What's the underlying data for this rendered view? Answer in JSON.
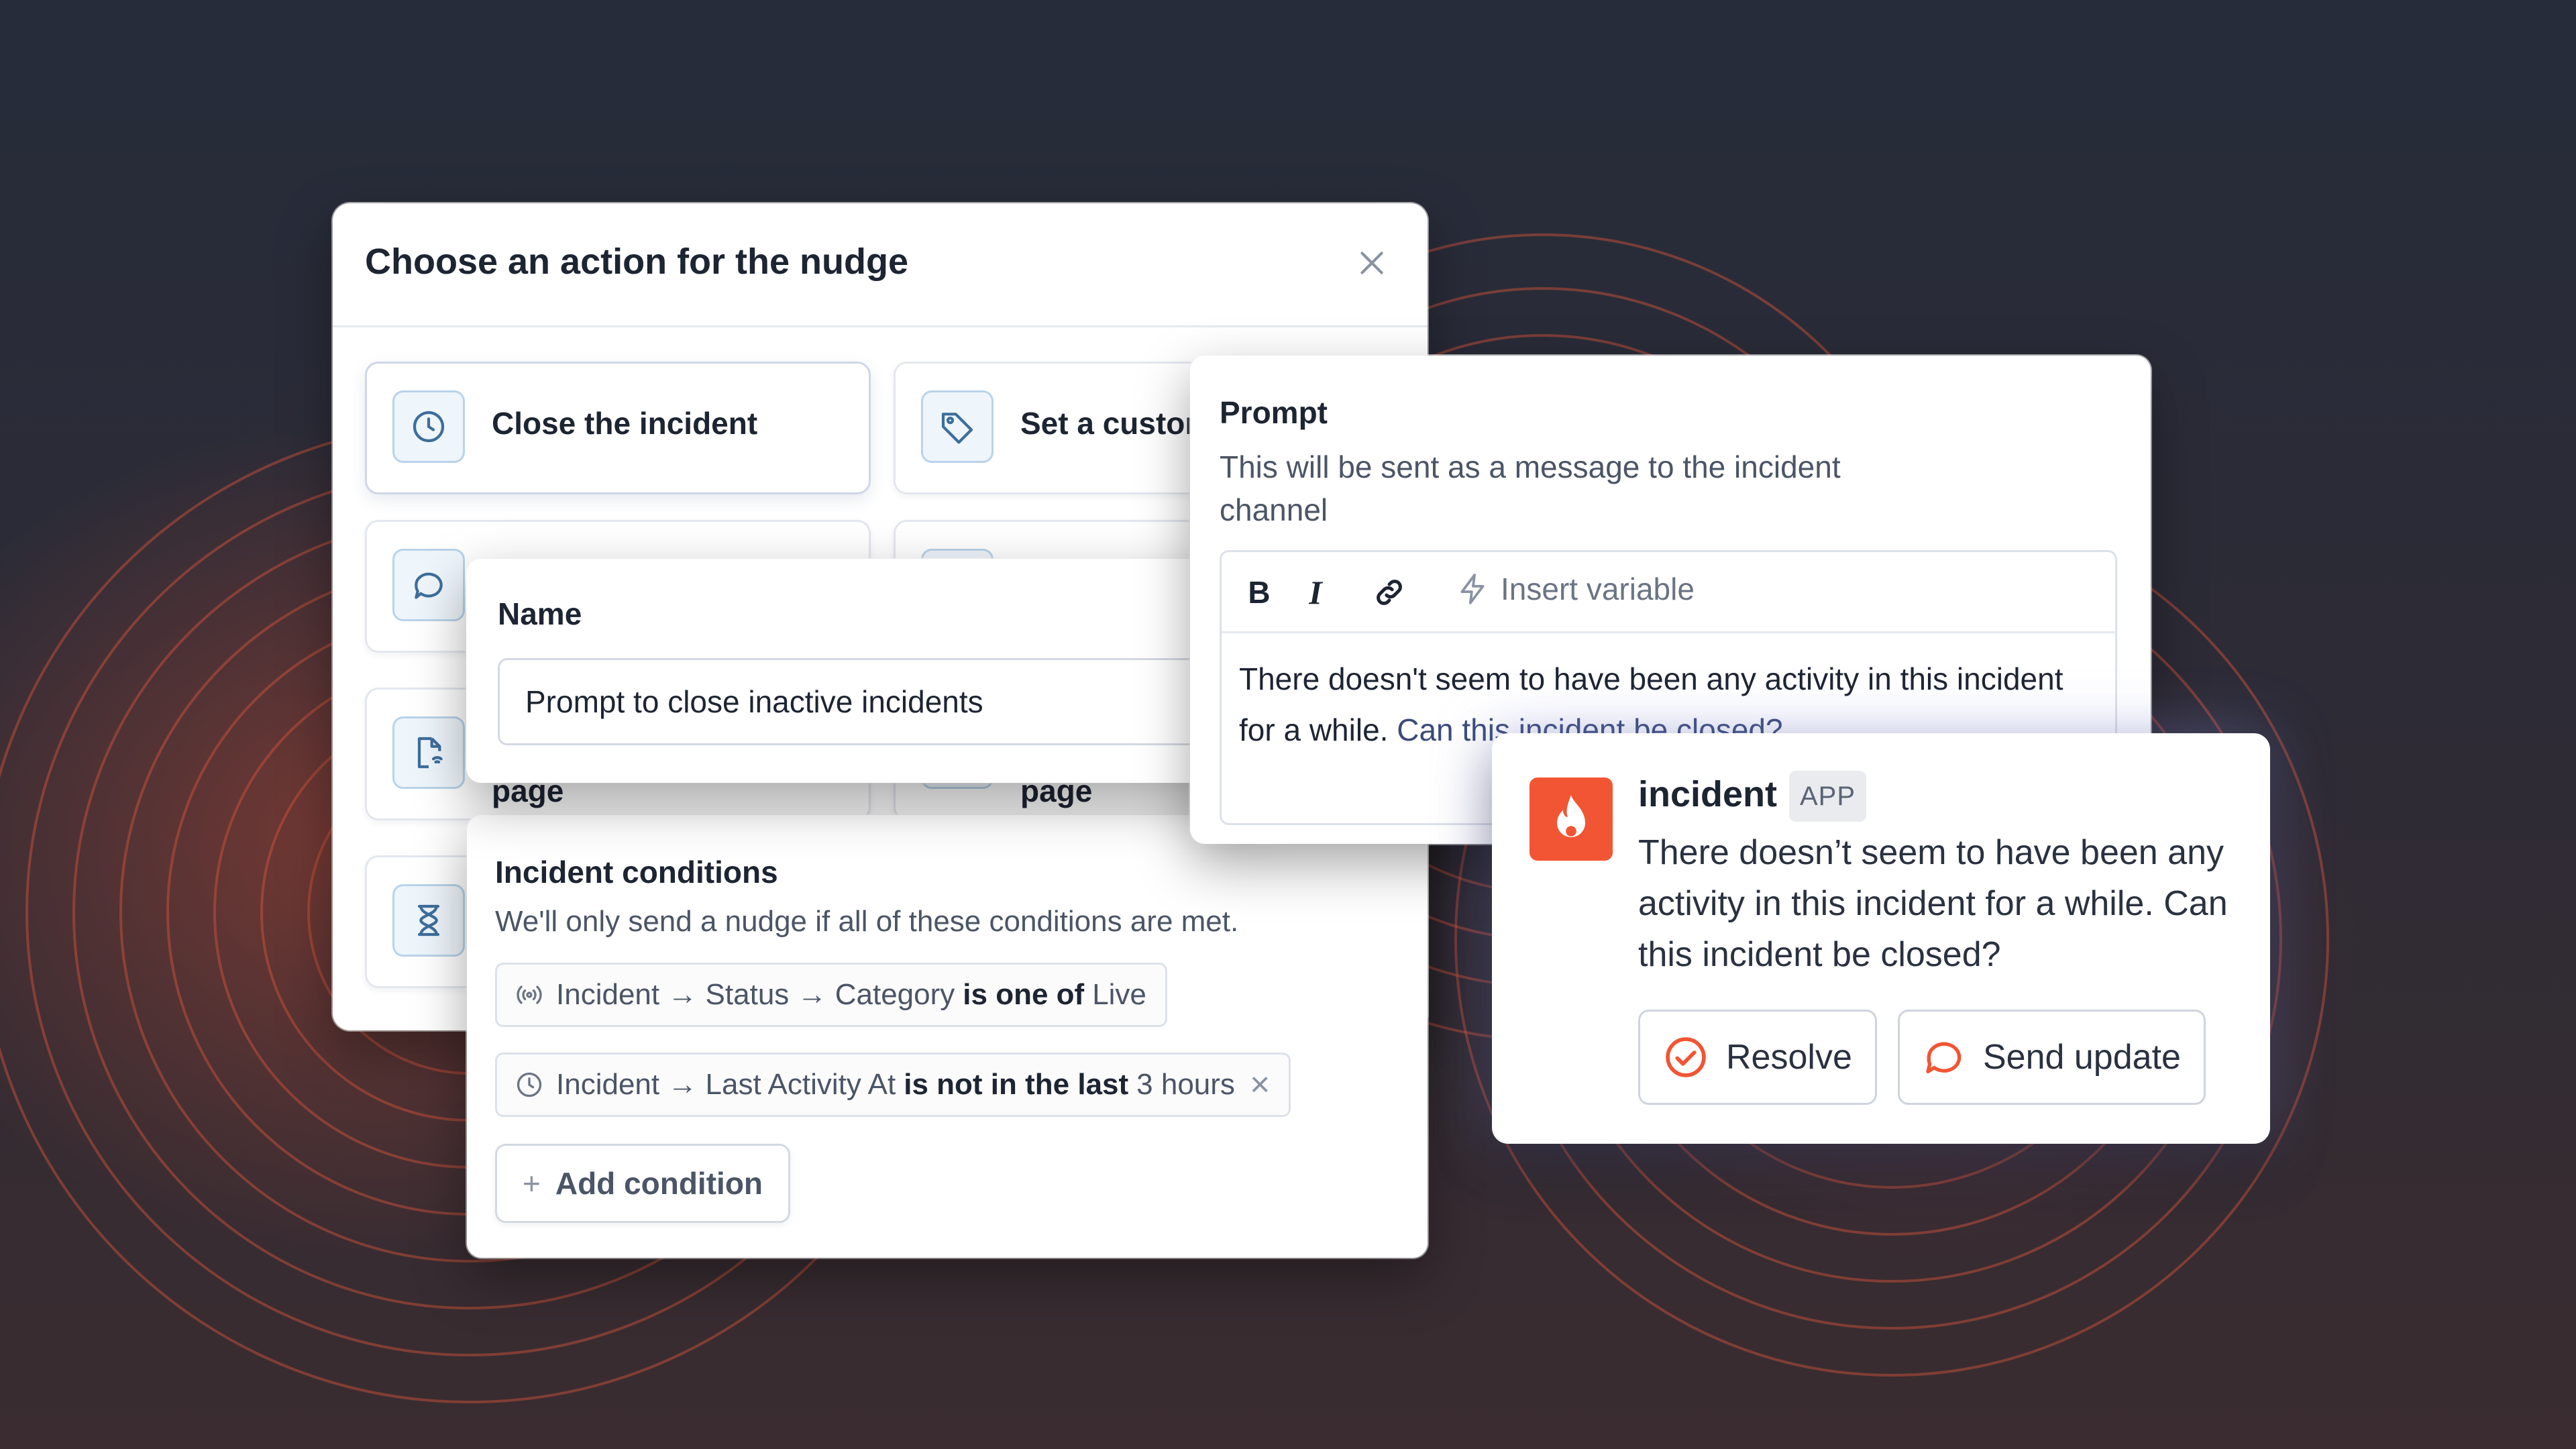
{
  "action_modal": {
    "title": "Choose an action for the nudge",
    "close_label": "×",
    "actions": [
      {
        "label": "Close the incident",
        "icon": "clock-icon"
      },
      {
        "label": "Set a custom",
        "icon": "tag-icon"
      },
      {
        "label": "",
        "icon": "chat-bubble-icon"
      },
      {
        "label": "",
        "icon": "blank-icon"
      },
      {
        "label": "page",
        "icon": "page-signal-icon"
      },
      {
        "label": "page",
        "icon": "blank-icon"
      },
      {
        "label": "",
        "icon": "hourglass-icon"
      }
    ]
  },
  "name_field": {
    "label": "Name",
    "value": "Prompt to close inactive incidents"
  },
  "conditions": {
    "title": "Incident conditions",
    "description": "We'll only send a nudge if all of these conditions are met.",
    "items": [
      {
        "icon": "signal-icon",
        "subject": "Incident → Status → Category",
        "operator": "is one of",
        "value": "Live",
        "removable": false
      },
      {
        "icon": "clock-icon",
        "subject": "Incident → Last Activity At",
        "operator": "is not in the last",
        "value": "3 hours",
        "removable": true
      }
    ],
    "add_label": "Add condition",
    "remove_label": "×",
    "add_prefix": "+"
  },
  "prompt": {
    "label": "Prompt",
    "description": "This will be sent as a message to the incident channel",
    "toolbar": {
      "bold": "B",
      "italic": "I",
      "insert_variable": "Insert variable"
    },
    "text": "There doesn't seem to have been any activity in this incident for a while.",
    "text_highlight": "Can this incident be closed?"
  },
  "message": {
    "app_name": "incident",
    "badge": "APP",
    "text": "There doesn’t seem to have been any activity in this incident for a while. Can this incident be closed?",
    "buttons": [
      {
        "label": "Resolve",
        "icon": "check-circle-icon"
      },
      {
        "label": "Send update",
        "icon": "chat-bubble-icon"
      }
    ],
    "accent": "#f25533"
  },
  "colors": {
    "background_top": "#262c3a",
    "background_bottom": "#3a2c30",
    "ring": "#d9553a",
    "icon_blue": "#3d6e9c"
  }
}
